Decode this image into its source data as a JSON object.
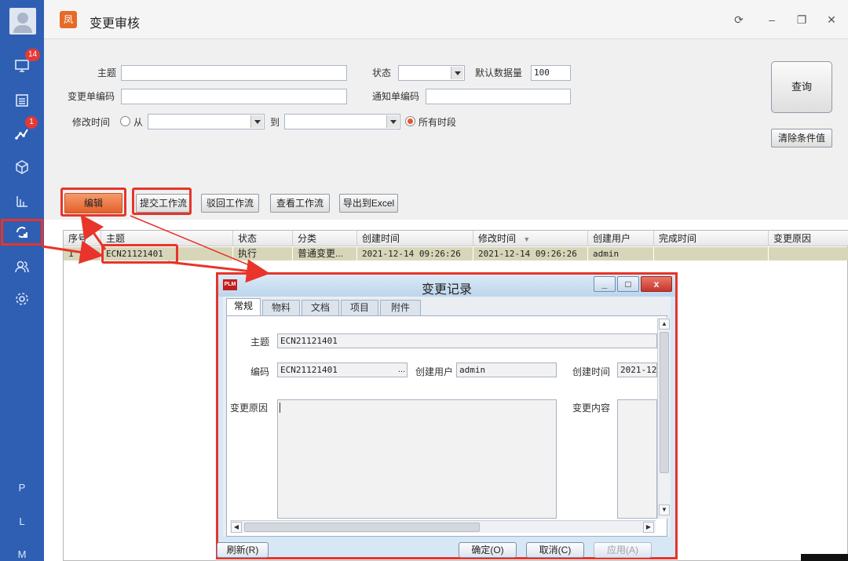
{
  "sidebar": {
    "badges": {
      "monitor": "14",
      "chart": "1"
    },
    "letters": [
      "P",
      "L",
      "M"
    ]
  },
  "window": {
    "title": "变更审核",
    "logo_glyph": "凤"
  },
  "query": {
    "subject_label": "主题",
    "subject_value": "",
    "status_label": "状态",
    "status_value": "",
    "default_count_label": "默认数据量",
    "default_count_value": "100",
    "change_no_label": "变更单编码",
    "change_no_value": "",
    "notice_no_label": "通知单编码",
    "notice_no_value": "",
    "modified_label": "修改时间",
    "from_label": "从",
    "to_label": "到",
    "all_time_label": "所有时段",
    "all_time_selected": true,
    "query_button": "查询",
    "clear_button": "清除条件值"
  },
  "toolbar": {
    "edit": "编辑",
    "submit_workflow": "提交工作流",
    "reject_workflow": "驳回工作流",
    "view_workflow": "查看工作流",
    "export_excel": "导出到Excel"
  },
  "grid": {
    "columns": [
      "序号",
      "主题",
      "状态",
      "分类",
      "创建时间",
      "修改时间",
      "创建用户",
      "完成时间",
      "变更原因"
    ],
    "rows": [
      {
        "no": "1",
        "subject": "ECN21121401",
        "status": "执行",
        "category": "普通变更...",
        "created": "2021-12-14 09:26:26",
        "modified": "2021-12-14 09:26:26",
        "user": "admin",
        "finished": "",
        "reason": ""
      }
    ]
  },
  "dialog": {
    "logo_text": "PLM",
    "title": "变更记录",
    "minimize": "_",
    "maximize": "□",
    "close": "x",
    "tabs": [
      "常规",
      "物料",
      "文档",
      "项目",
      "附件"
    ],
    "active_tab": "常规",
    "subject_label": "主题",
    "subject_value": "ECN21121401",
    "code_label": "编码",
    "code_value": "ECN21121401",
    "code_browse": "...",
    "creator_label": "创建用户",
    "creator_value": "admin",
    "created_label": "创建时间",
    "created_value": "2021-12-",
    "reason_label": "变更原因",
    "reason_value": "",
    "content_label": "变更内容",
    "buttons": {
      "refresh": "刷新(R)",
      "ok": "确定(O)",
      "cancel": "取消(C)",
      "apply": "应用(A)"
    }
  }
}
